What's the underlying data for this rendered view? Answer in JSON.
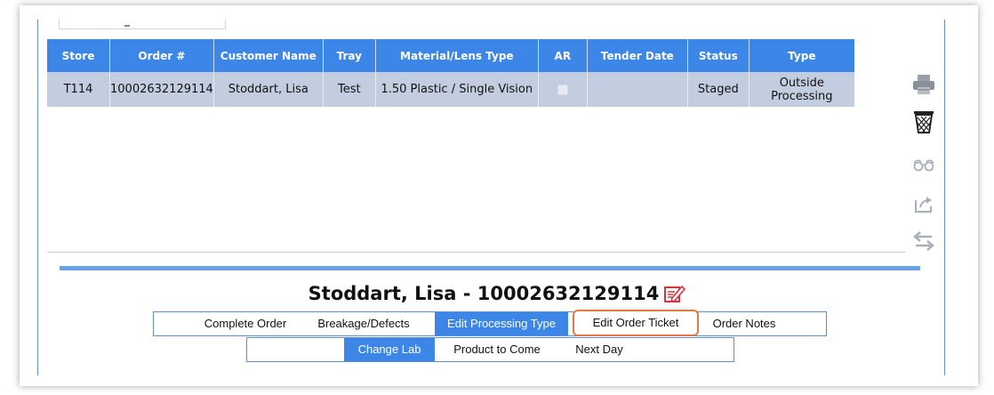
{
  "table": {
    "headers": [
      "Store",
      "Order #",
      "Customer Name",
      "Tray",
      "Material/Lens Type",
      "AR",
      "Tender Date",
      "Status",
      "Type"
    ],
    "rows": [
      {
        "store": "T114",
        "order": "10002632129114",
        "customer": "Stoddart, Lisa",
        "tray": "Test",
        "material": "1.50 Plastic / Single Vision",
        "ar_checked": false,
        "tender_date": "",
        "status": "Staged",
        "type": "Outside Processing"
      }
    ]
  },
  "side_icons": [
    "printer-icon",
    "trash-icon",
    "glasses-icon",
    "share-icon",
    "swap-icon"
  ],
  "order_title": "Stoddart, Lisa - 10002632129114",
  "nav_primary": {
    "complete_order": "Complete Order",
    "breakage": "Breakage/Defects",
    "edit_processing": "Edit Processing Type",
    "edit_ticket": "Edit Order Ticket",
    "order_notes": "Order Notes"
  },
  "nav_secondary": {
    "change_lab": "Change Lab",
    "product_to_come": "Product to Come",
    "next_day": "Next Day"
  },
  "colors": {
    "header_blue": "#3c86e8",
    "row_bg": "#c3cde0",
    "highlight_orange": "#e9773f",
    "edit_icon_red": "#d8343b"
  }
}
